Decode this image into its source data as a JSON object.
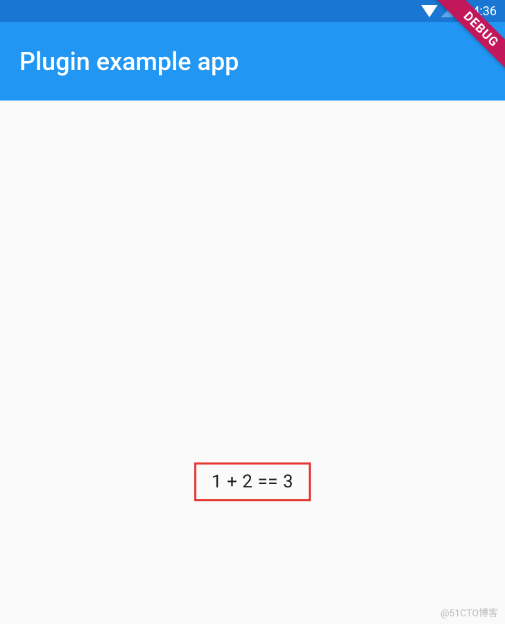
{
  "statusBar": {
    "time": "4:36"
  },
  "appBar": {
    "title": "Plugin example app"
  },
  "body": {
    "resultText": "1 + 2 == 3"
  },
  "debugBanner": {
    "label": "DEBUG"
  },
  "watermark": {
    "text": "@51CTO博客"
  }
}
